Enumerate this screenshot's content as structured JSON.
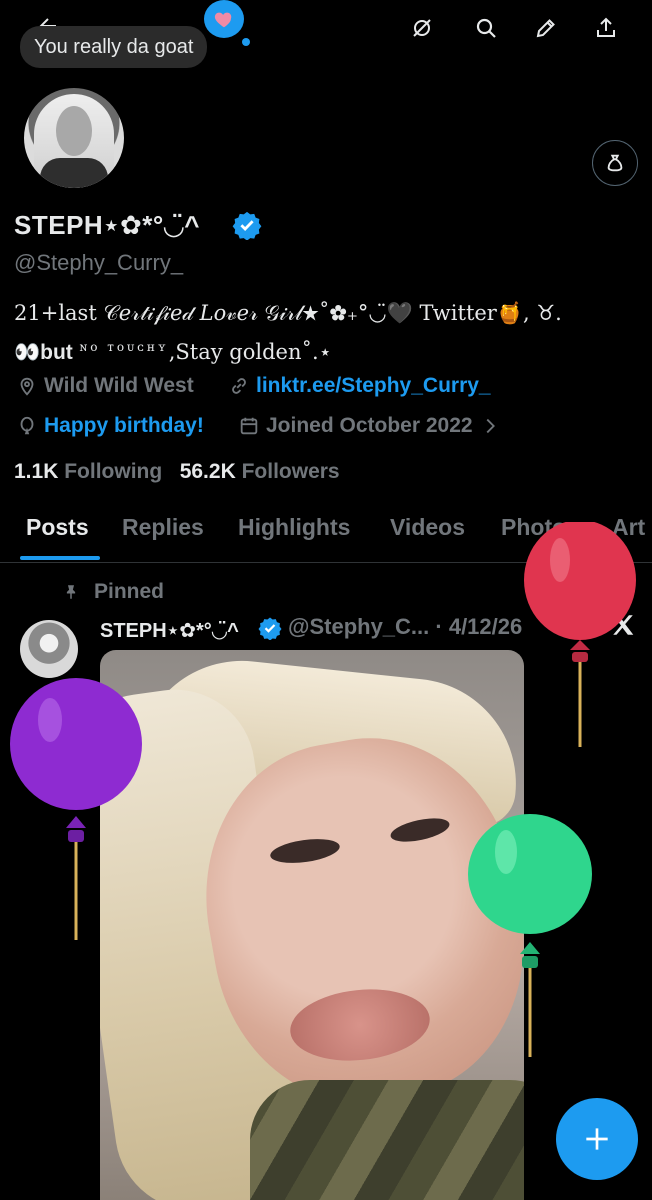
{
  "top_bar": {
    "speech_bubble_text": "You really da goat",
    "icons": [
      "back-arrow-icon",
      "heart-icon",
      "retweet-circle-icon",
      "search-icon",
      "edit-pen-icon",
      "share-icon"
    ]
  },
  "profile": {
    "display_name": "STEPH⋆✿*°◡̈^",
    "handle": "@Stephy_Curry_",
    "bio_line1": "21+last 𝒞𝑒𝓇𝓉𝒾𝒻𝒾𝑒𝒹 𝐿𝑜𝓋𝑒𝓇 𝒢𝒾𝓇𝓁★˚✿₊°◡̈🖤 Twitter🍯, ♉︎.",
    "bio_line2_prefix": "👀but",
    "bio_line2_smallcaps": "ɴᴏ ᴛᴏᴜᴄʜʏ",
    "bio_line2_suffix": ",Stay golden˚.⋆",
    "location": "Wild Wild West",
    "website": "linktr.ee/Stephy_Curry_",
    "birthday": "Happy birthday!",
    "joined": "Joined October 2022",
    "following_count": "1.1K",
    "following_label": "Following",
    "followers_count": "56.2K",
    "followers_label": "Followers"
  },
  "tabs": [
    "Posts",
    "Replies",
    "Highlights",
    "Videos",
    "Photos",
    "Art"
  ],
  "active_tab": "Posts",
  "pinned_post": {
    "pinned_label": "Pinned",
    "author_name": "STEPH⋆✿*°◡̈^",
    "author_handle": "@Stephy_C...",
    "date": "· 4/12/26"
  },
  "colors": {
    "accent": "#1d9bf0",
    "background": "#000000",
    "muted_text": "#71767b",
    "balloon_red": "#e0354f",
    "balloon_purple": "#8e2bd1",
    "balloon_green": "#2fd68d"
  }
}
